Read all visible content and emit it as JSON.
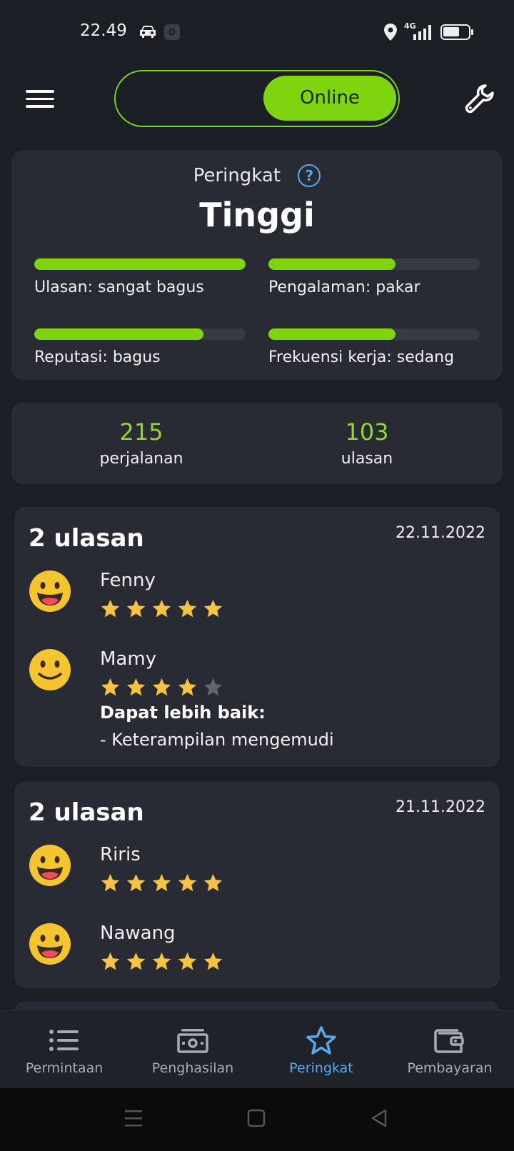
{
  "status_bar": {
    "time": "22.49",
    "network": "4G",
    "icons": [
      "car-icon",
      "d-app-icon",
      "location-icon",
      "signal-icon",
      "battery-icon"
    ]
  },
  "top_bar": {
    "status_toggle": "Online",
    "colors": {
      "accent": "#7fd410",
      "link": "#5aa8f0"
    }
  },
  "rating": {
    "title": "Peringkat",
    "level": "Tinggi",
    "metrics": [
      {
        "label": "Ulasan: sangat bagus",
        "fill": 1.0
      },
      {
        "label": "Pengalaman: pakar",
        "fill": 0.6
      },
      {
        "label": "Reputasi: bagus",
        "fill": 0.8
      },
      {
        "label": "Frekuensi kerja: sedang",
        "fill": 0.6
      }
    ]
  },
  "counts": {
    "trips": {
      "value": "215",
      "label": "perjalanan"
    },
    "reviews": {
      "value": "103",
      "label": "ulasan"
    }
  },
  "review_groups": [
    {
      "title": "2 ulasan",
      "date": "22.11.2022",
      "reviews": [
        {
          "name": "Fenny",
          "stars": 5,
          "emoji": "grinning-face-icon"
        },
        {
          "name": "Mamy",
          "stars": 4,
          "emoji": "smiling-face-icon",
          "improve_title": "Dapat lebih baik:",
          "improve_item": "- Keterampilan mengemudi"
        }
      ]
    },
    {
      "title": "2 ulasan",
      "date": "21.11.2022",
      "reviews": [
        {
          "name": "Riris",
          "stars": 5,
          "emoji": "grinning-face-icon"
        },
        {
          "name": "Nawang",
          "stars": 5,
          "emoji": "grinning-face-icon"
        }
      ]
    }
  ],
  "bottom_nav": [
    {
      "label": "Permintaan",
      "icon": "list-icon"
    },
    {
      "label": "Penghasilan",
      "icon": "money-icon"
    },
    {
      "label": "Peringkat",
      "icon": "star-icon",
      "active": true
    },
    {
      "label": "Pembayaran",
      "icon": "wallet-icon"
    }
  ]
}
